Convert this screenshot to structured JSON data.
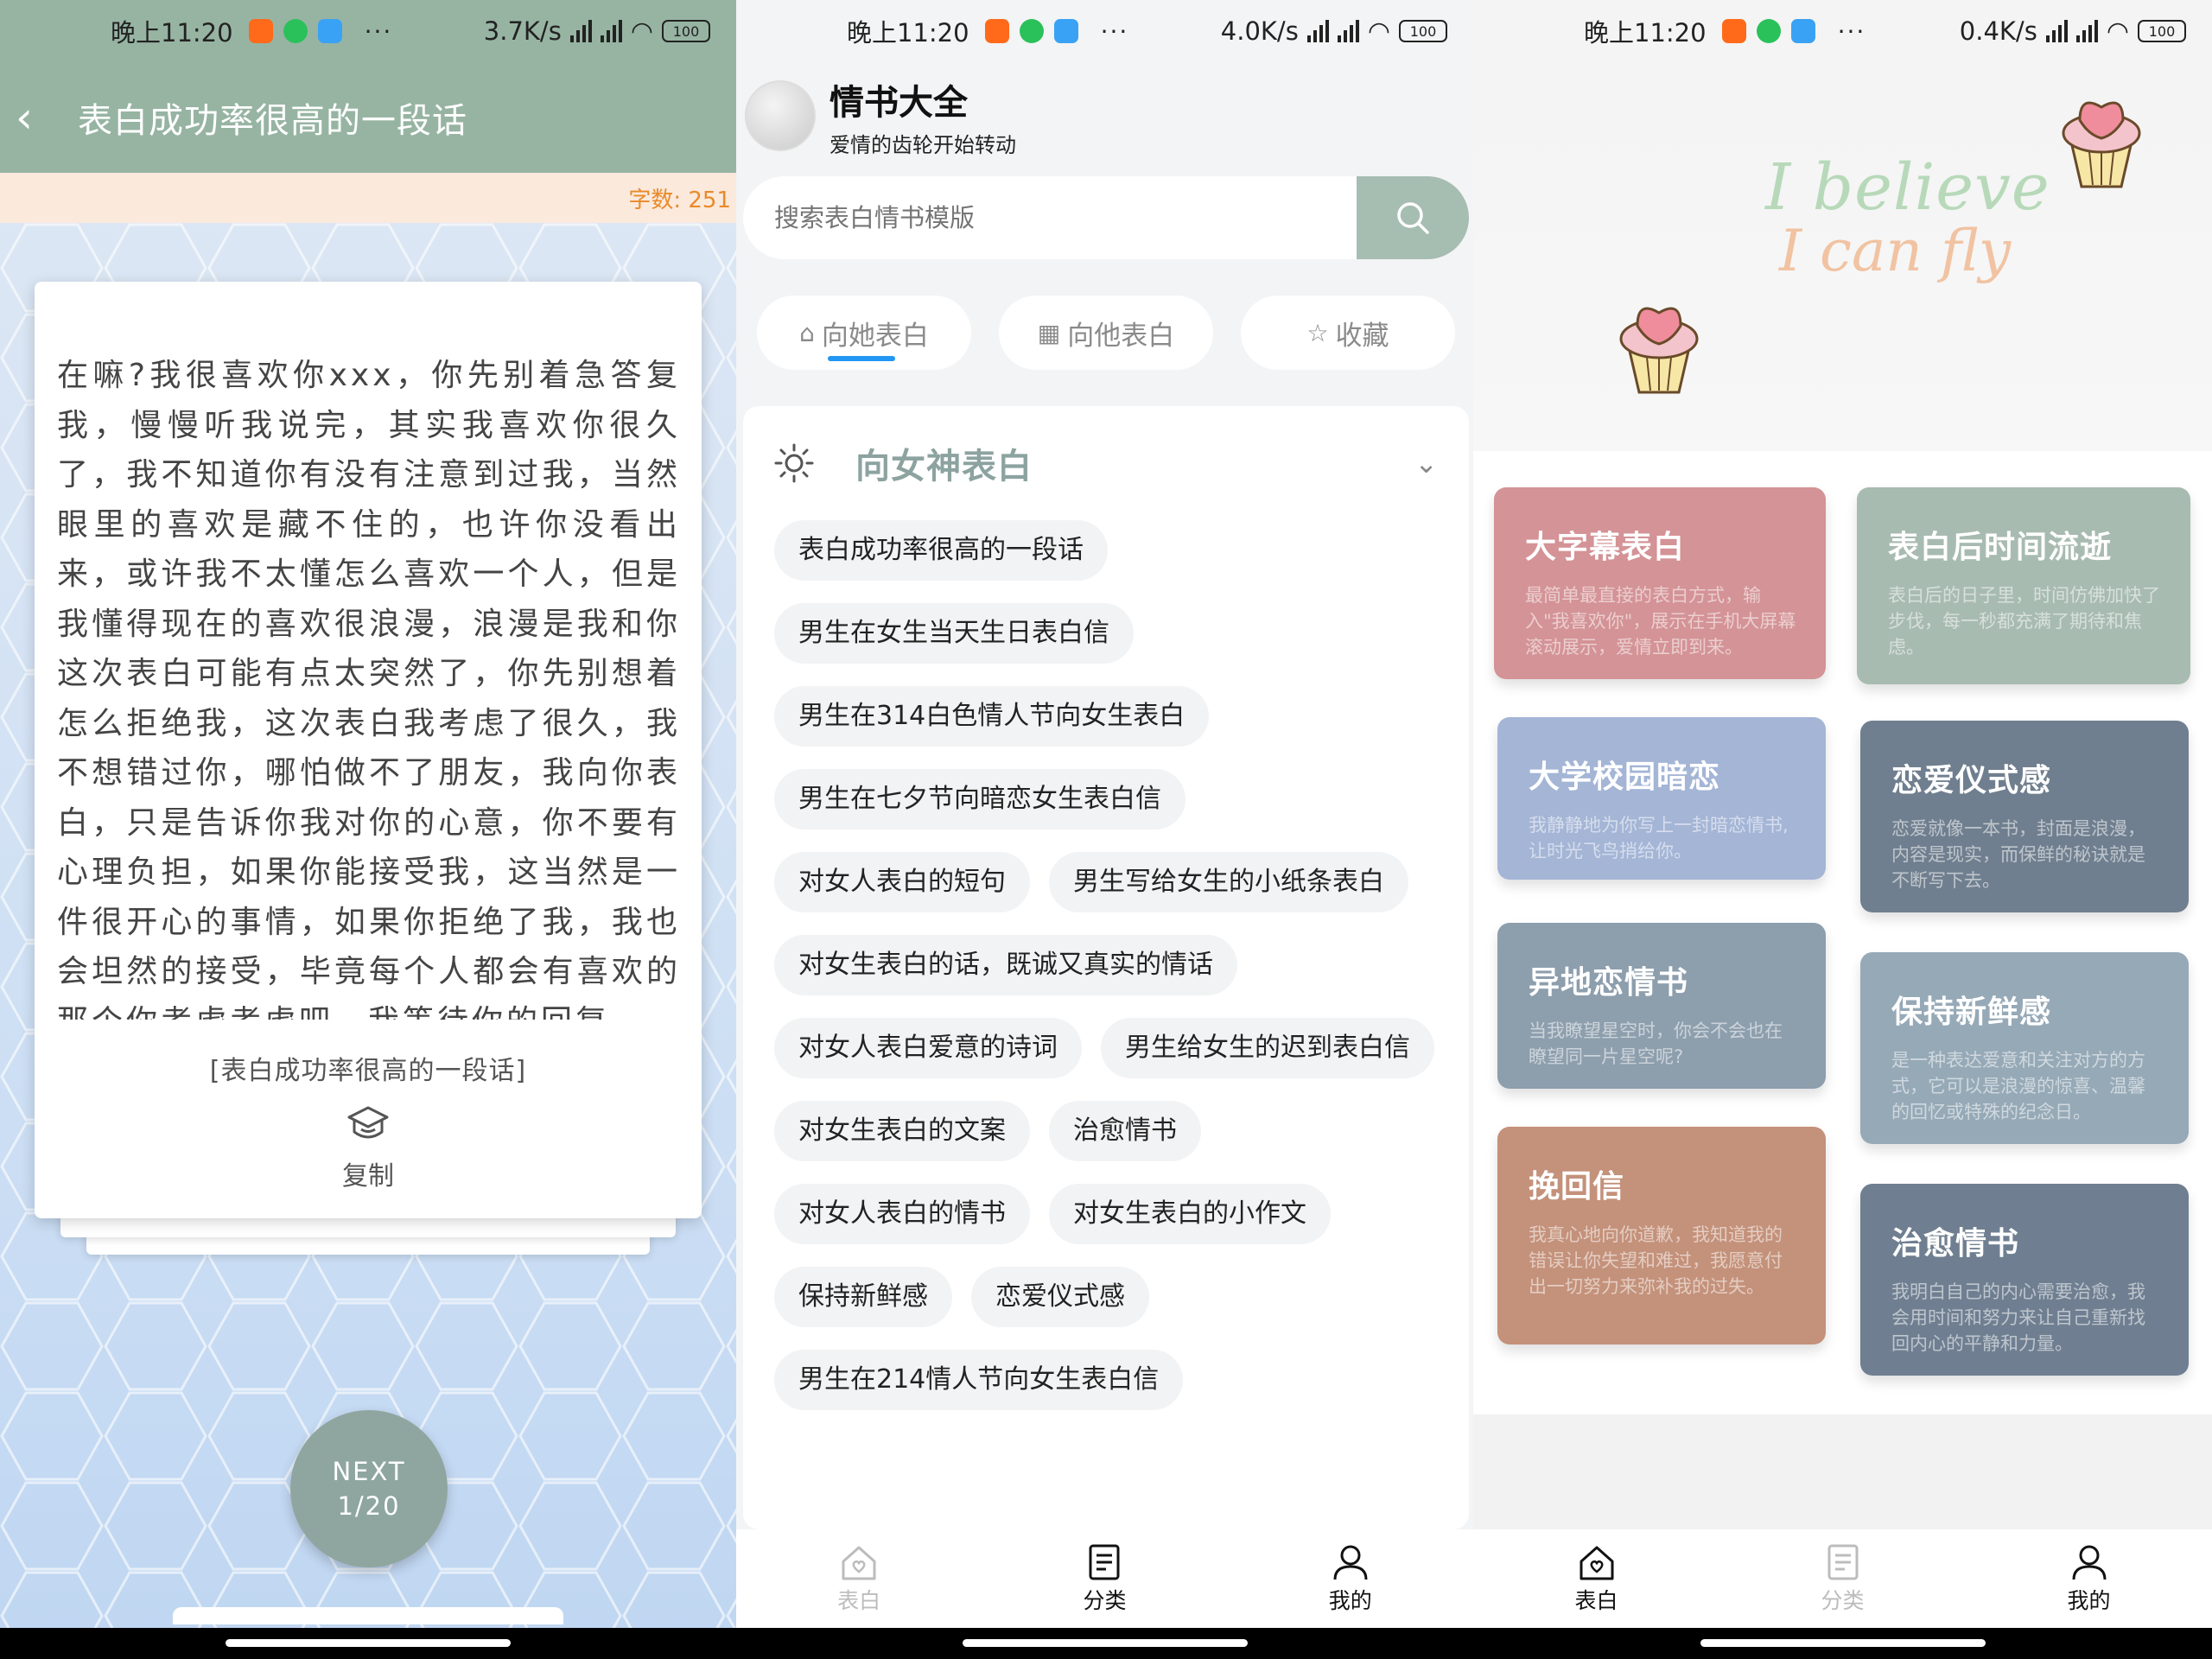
{
  "status_bars": [
    {
      "time": "晚上11:20",
      "speed": "3.7K/s",
      "battery": "100"
    },
    {
      "time": "晚上11:20",
      "speed": "4.0K/s",
      "battery": "100"
    },
    {
      "time": "晚上11:20",
      "speed": "0.4K/s",
      "battery": "100"
    }
  ],
  "detail": {
    "title": "表白成功率很高的一段话",
    "word_count": "字数: 251",
    "body": "在嘛?我很喜欢你xxx，你先别着急答复我，慢慢听我说完，其实我喜欢你很久了，我不知道你有没有注意到过我，当然眼里的喜欢是藏不住的，也许你没看出来，或许我不太懂怎么喜欢一个人，但是我懂得现在的喜欢很浪漫，浪漫是我和你这次表白可能有点太突然了，你先别想着怎么拒绝我，这次表白我考虑了很久，我不想错过你，哪怕做不了朋友，我向你表白，只是告诉你我对你的心意，你不要有心理负担，如果你能接受我，这当然是一件很开心的事情，如果你拒绝了我，我也会坦然的接受，毕竟每个人都会有喜欢的那个你考虑考虑吧，我等待你的回复",
    "caption": "[表白成功率很高的一段话]",
    "copy_label": "复制",
    "next_label": "NEXT",
    "page": "1/20"
  },
  "home": {
    "app_title": "情书大全",
    "subtitle": "爱情的齿轮开始转动",
    "search_placeholder": "搜索表白情书模版",
    "tabs": [
      {
        "label": "向她表白",
        "icon": "home-icon"
      },
      {
        "label": "向他表白",
        "icon": "grid-icon"
      },
      {
        "label": "收藏",
        "icon": "star-icon"
      }
    ],
    "section_title": "向女神表白",
    "chips": [
      "表白成功率很高的一段话",
      "男生在女生当天生日表白信",
      "男生在314白色情人节向女生表白",
      "男生在七夕节向暗恋女生表白信",
      "对女人表白的短句",
      "男生写给女生的小纸条表白",
      "对女生表白的话，既诚又真实的情话",
      "对女人表白爱意的诗词",
      "男生给女生的迟到表白信",
      "对女生表白的文案",
      "治愈情书",
      "对女人表白的情书",
      "对女生表白的小作文",
      "保持新鲜感",
      "恋爱仪式感",
      "男生在214情人节向女生表白信"
    ]
  },
  "nav": {
    "items": [
      {
        "label": "表白",
        "icon": "home-heart-icon"
      },
      {
        "label": "分类",
        "icon": "list-icon"
      },
      {
        "label": "我的",
        "icon": "user-icon"
      }
    ]
  },
  "category": {
    "banner_line1": "I believe",
    "banner_line2": "I can fly",
    "cards": [
      {
        "title": "大字幕表白",
        "desc": "最简单最直接的表白方式，输入\"我喜欢你\"，展示在手机大屏幕滚动展示，爱情立即到来。",
        "color": "#d49396"
      },
      {
        "title": "表白后时间流逝",
        "desc": "表白后的日子里，时间仿佛加快了步伐，每一秒都充满了期待和焦虑。",
        "color": "#a8bbb1"
      },
      {
        "title": "大学校园暗恋",
        "desc": "我静静地为你写上一封暗恋情书,让时光飞鸟捎给你。",
        "color": "#a4b5d6"
      },
      {
        "title": "恋爱仪式感",
        "desc": "恋爱就像一本书，封面是浪漫，内容是现实，而保鲜的秘诀就是不断写下去。",
        "color": "#707f8f"
      },
      {
        "title": "异地恋情书",
        "desc": "当我瞭望星空时，你会不会也在瞭望同一片星空呢?",
        "color": "#8d9ead"
      },
      {
        "title": "保持新鲜感",
        "desc": "是一种表达爱意和关注对方的方式，它可以是浪漫的惊喜、温馨的回忆或特殊的纪念日。",
        "color": "#96a9b7"
      },
      {
        "title": "挽回信",
        "desc": "我真心地向你道歉，我知道我的错误让你失望和难过，我愿意付出一切努力来弥补我的过失。",
        "color": "#c4917a"
      },
      {
        "title": "治愈情书",
        "desc": "我明白自己的内心需要治愈，我会用时间和努力来让自己重新找回内心的平静和力量。",
        "color": "#6f7f91"
      }
    ]
  }
}
